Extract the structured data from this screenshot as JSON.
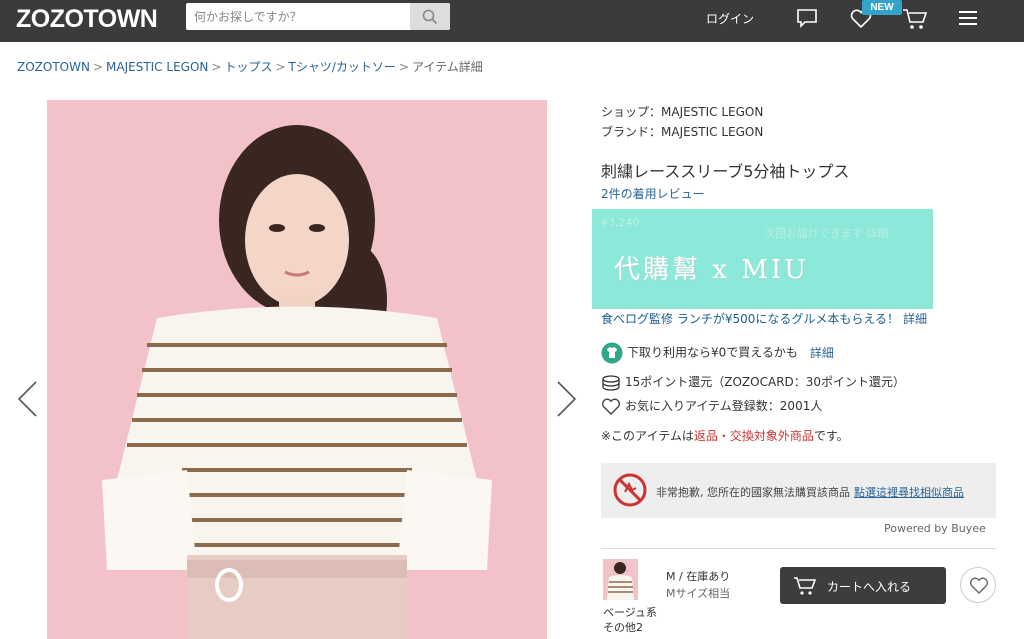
{
  "header": {
    "logo": "ZOZOTOWN",
    "search_placeholder": "何かお探しですか？",
    "login": "ログイン",
    "new_badge": "NEW"
  },
  "breadcrumb": {
    "items": [
      "ZOZOTOWN",
      "MAJESTIC LEGON",
      "トップス",
      "Tシャツ/カットソー"
    ],
    "current": "アイテム詳細",
    "separator": ">"
  },
  "product": {
    "shop": "ショップ：MAJESTIC LEGON",
    "brand": "ブランド：MAJESTIC LEGON",
    "title": "刺繍レーススリーブ5分袖トップス",
    "reviews": "2件の着用レビュー",
    "price_faint": "¥3,240",
    "price_faint_note": "次回お届けできます 詳細",
    "watermark": "代購幫 x MIU",
    "promo_main": "食べログ監修 ランチが¥500になるグルメ本もらえる！",
    "promo_detail": "詳細",
    "tradein_text": "下取り利用なら¥0で買えるかも",
    "tradein_detail": "詳細",
    "points": "15ポイント還元（ZOZOCARD：30ポイント還元）",
    "favorites": "お気に入りアイテム登録数：2001人",
    "notice_prefix": "※このアイテムは",
    "notice_link": "返品・交換対象外商品",
    "notice_suffix": "です。"
  },
  "buyee": {
    "message": "非常抱歉, 您所在的國家無法購買該商品",
    "link": "點選這裡尋找相似商品",
    "powered": "Powered by Buyee"
  },
  "variant": {
    "color_line1": "ベージュ系",
    "color_line2": "その他2",
    "size": "M / 在庫あり",
    "size_note": "Mサイズ相当",
    "cart_button": "カートへ入れる"
  },
  "colors": {
    "header_bg": "#3b3b3b",
    "link": "#2a6496",
    "watermark_bg": "#8ce8d8",
    "image_bg": "#f2c2c8",
    "cart_bg": "#3d3d3d",
    "badge": "#33a3c9"
  },
  "icons": {
    "search": "search-icon",
    "chat": "chat-icon",
    "heart": "heart-icon",
    "cart": "cart-icon",
    "menu": "hamburger-menu-icon",
    "prev": "chevron-left-icon",
    "next": "chevron-right-icon"
  }
}
